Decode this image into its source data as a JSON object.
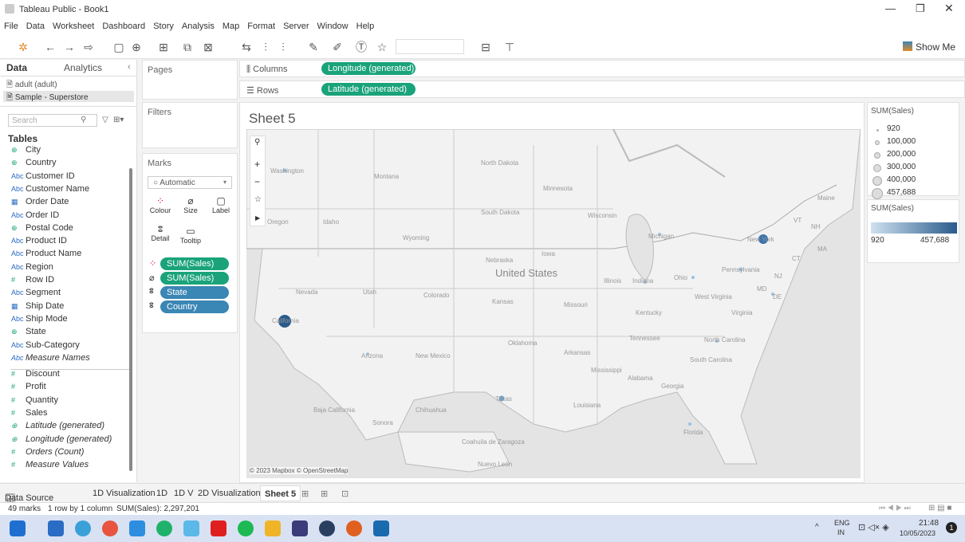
{
  "app": {
    "title": "Tableau Public - Book1"
  },
  "menu": [
    "File",
    "Data",
    "Worksheet",
    "Dashboard",
    "Story",
    "Analysis",
    "Map",
    "Format",
    "Server",
    "Window",
    "Help"
  ],
  "toolbar": {
    "show_me": "Show Me"
  },
  "data_pane": {
    "tabs": [
      "Data",
      "Analytics"
    ],
    "sources": [
      "adult (adult)",
      "Sample - Superstore"
    ],
    "search_placeholder": "Search",
    "tables_heading": "Tables",
    "fields": [
      {
        "icon": "globe",
        "name": "City",
        "italic": false
      },
      {
        "icon": "globe",
        "name": "Country",
        "italic": false
      },
      {
        "icon": "Abc",
        "name": "Customer ID",
        "italic": false
      },
      {
        "icon": "Abc",
        "name": "Customer Name",
        "italic": false
      },
      {
        "icon": "calendar",
        "name": "Order Date",
        "italic": false
      },
      {
        "icon": "Abc",
        "name": "Order ID",
        "italic": false
      },
      {
        "icon": "globe",
        "name": "Postal Code",
        "italic": false
      },
      {
        "icon": "Abc",
        "name": "Product ID",
        "italic": false
      },
      {
        "icon": "Abc",
        "name": "Product Name",
        "italic": false
      },
      {
        "icon": "Abc",
        "name": "Region",
        "italic": false
      },
      {
        "icon": "#",
        "name": "Row ID",
        "italic": false
      },
      {
        "icon": "Abc",
        "name": "Segment",
        "italic": false
      },
      {
        "icon": "calendar",
        "name": "Ship Date",
        "italic": false
      },
      {
        "icon": "Abc",
        "name": "Ship Mode",
        "italic": false
      },
      {
        "icon": "globe",
        "name": "State",
        "italic": false
      },
      {
        "icon": "Abc",
        "name": "Sub-Category",
        "italic": false
      },
      {
        "icon": "Abc",
        "name": "Measure Names",
        "italic": true
      },
      {
        "icon": "#",
        "name": "Discount",
        "italic": false
      },
      {
        "icon": "#",
        "name": "Profit",
        "italic": false
      },
      {
        "icon": "#",
        "name": "Quantity",
        "italic": false
      },
      {
        "icon": "#",
        "name": "Sales",
        "italic": false
      },
      {
        "icon": "globe",
        "name": "Latitude (generated)",
        "italic": true
      },
      {
        "icon": "globe",
        "name": "Longitude (generated)",
        "italic": true
      },
      {
        "icon": "#",
        "name": "Orders (Count)",
        "italic": true
      },
      {
        "icon": "#",
        "name": "Measure Values",
        "italic": true
      }
    ]
  },
  "cards": {
    "pages": "Pages",
    "filters": "Filters",
    "marks": "Marks",
    "mark_type": "Automatic",
    "mark_buttons": [
      "Colour",
      "Size",
      "Label",
      "Detail",
      "Tooltip"
    ],
    "mark_pills": [
      "SUM(Sales)",
      "SUM(Sales)",
      "State",
      "Country"
    ]
  },
  "shelves": {
    "columns_label": "Columns",
    "columns_pill": "Longitude (generated)",
    "rows_label": "Rows",
    "rows_pill": "Latitude (generated)"
  },
  "sheet": {
    "title": "Sheet 5",
    "attribution": "© 2023 Mapbox © OpenStreetMap"
  },
  "map_labels": [
    "North Dakota",
    "Montana",
    "Minnesota",
    "South Dakota",
    "Wisconsin",
    "Michigan",
    "Idaho",
    "Wyoming",
    "Iowa",
    "Nebraska",
    "United States",
    "Nevada",
    "Utah",
    "Colorado",
    "Kansas",
    "Missouri",
    "Illinois",
    "Indiana",
    "Ohio",
    "Pennsylvania",
    "West Virginia",
    "Virginia",
    "Kentucky",
    "Tennessee",
    "North Carolina",
    "South Carolina",
    "Oklahoma",
    "Arkansas",
    "Arizona",
    "New Mexico",
    "Mississippi",
    "Alabama",
    "Georgia",
    "Louisiana",
    "Florida",
    "Baja California",
    "Sonora",
    "Chihuahua",
    "Coahuila de Zaragoza",
    "Nuevo León",
    "Maine",
    "VT",
    "NH",
    "MA",
    "CT",
    "NJ",
    "MD",
    "DE",
    "Oregon",
    "Washington",
    "Texas",
    "California",
    "New York"
  ],
  "legend_size": {
    "title": "SUM(Sales)",
    "items": [
      "920",
      "100,000",
      "200,000",
      "300,000",
      "400,000",
      "457,688"
    ]
  },
  "legend_color": {
    "title": "SUM(Sales)",
    "min": "920",
    "max": "457,688"
  },
  "tabs": [
    "Data Source",
    "1D Visualization",
    "1D",
    "1D V",
    "2D Visualization",
    "Sheet 5"
  ],
  "status": {
    "marks": "49 marks",
    "rows": "1 row by 1 column",
    "sum": "SUM(Sales): 2,297,201"
  },
  "taskbar": {
    "lang1": "ENG",
    "lang2": "IN",
    "time": "21:48",
    "date": "10/05/2023"
  }
}
